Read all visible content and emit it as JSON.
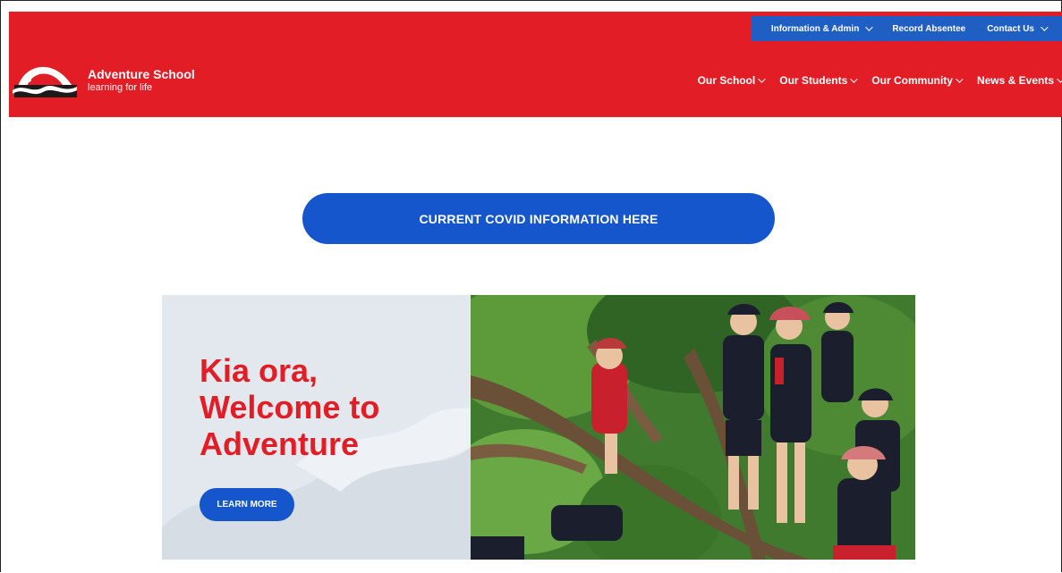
{
  "site": {
    "name": "Adventure School",
    "tagline": "learning for life"
  },
  "utility_nav": [
    {
      "label": "Information & Admin",
      "has_dropdown": true
    },
    {
      "label": "Record Absentee",
      "has_dropdown": false
    },
    {
      "label": "Contact Us",
      "has_dropdown": true
    }
  ],
  "main_nav": [
    {
      "label": "Our School",
      "has_dropdown": true
    },
    {
      "label": "Our Students",
      "has_dropdown": true
    },
    {
      "label": "Our Community",
      "has_dropdown": true
    },
    {
      "label": "News & Events",
      "has_dropdown": true
    }
  ],
  "covid_button": "CURRENT COVID INFORMATION HERE",
  "hero": {
    "line1": "Kia ora,",
    "line2": "Welcome to",
    "line3": "Adventure",
    "cta": "LEARN MORE"
  },
  "colors": {
    "brand_red": "#e21d25",
    "brand_blue": "#1656cc",
    "utility_blue": "#1f5fc4",
    "hero_panel": "#e3e8ee"
  },
  "icons": [
    "school-logo-icon",
    "chevron-down-icon"
  ]
}
